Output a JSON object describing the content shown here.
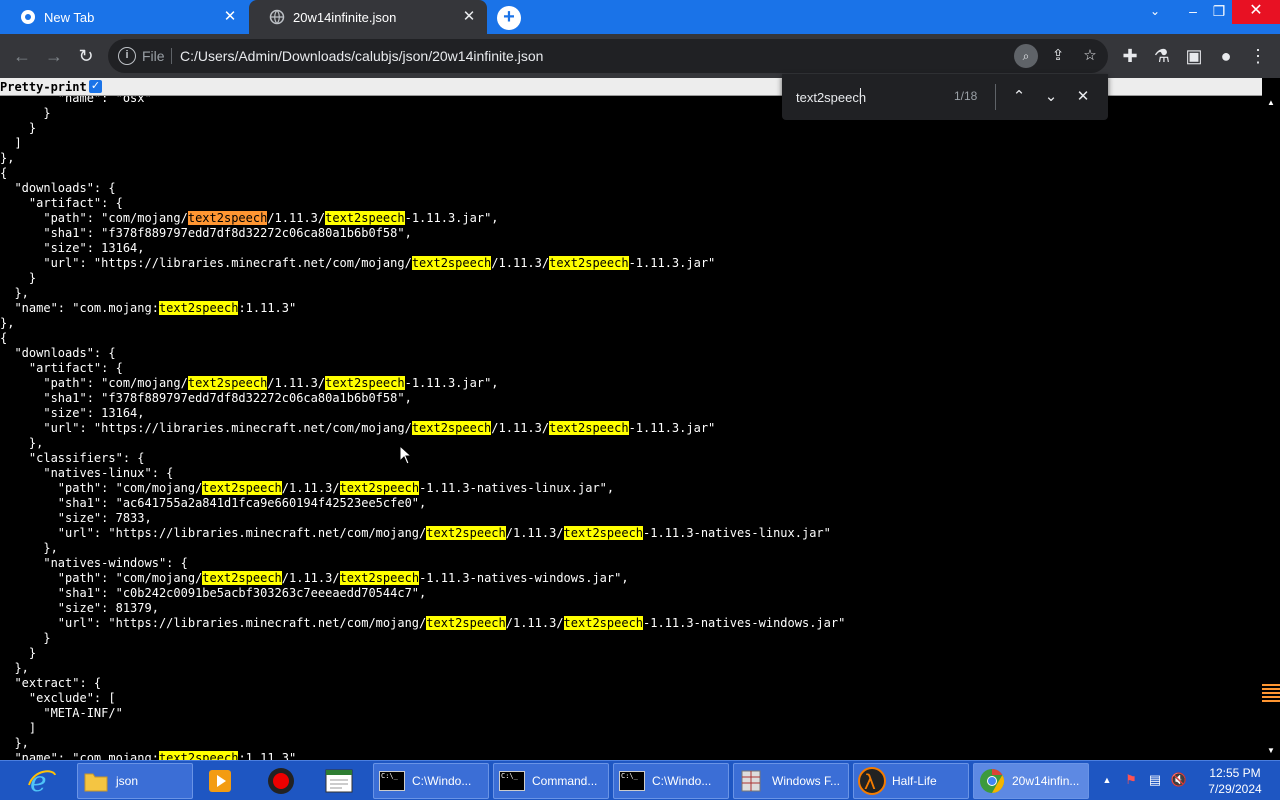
{
  "browser": {
    "tabs": [
      {
        "label": "New Tab",
        "active": false
      },
      {
        "label": "20w14infinite.json",
        "active": true
      }
    ],
    "address": {
      "scheme_label": "File",
      "url": "C:/Users/Admin/Downloads/calubjs/json/20w14infinite.json"
    }
  },
  "viewer": {
    "pretty_print_label": "Pretty-print",
    "pretty_print_checked": true
  },
  "find": {
    "query": "text2speech",
    "count": "1/18"
  },
  "code_lines": [
    [
      [
        "        \"name\": \"osx\"",
        false
      ]
    ],
    [
      [
        "      }",
        false
      ]
    ],
    [
      [
        "    }",
        false
      ]
    ],
    [
      [
        "  ]",
        false
      ]
    ],
    [
      [
        "},",
        false
      ]
    ],
    [
      [
        "{",
        false
      ]
    ],
    [
      [
        "  \"downloads\": {",
        false
      ]
    ],
    [
      [
        "    \"artifact\": {",
        false
      ]
    ],
    [
      [
        "      \"path\": \"com/mojang/",
        false
      ],
      [
        "text2speech",
        "active"
      ],
      [
        "/1.11.3/",
        false
      ],
      [
        "text2speech",
        true
      ],
      [
        "-1.11.3.jar\",",
        false
      ]
    ],
    [
      [
        "      \"sha1\": \"f378f889797edd7df8d32272c06ca80a1b6b0f58\",",
        false
      ]
    ],
    [
      [
        "      \"size\": 13164,",
        false
      ]
    ],
    [
      [
        "      \"url\": \"https://libraries.minecraft.net/com/mojang/",
        false
      ],
      [
        "text2speech",
        true
      ],
      [
        "/1.11.3/",
        false
      ],
      [
        "text2speech",
        true
      ],
      [
        "-1.11.3.jar\"",
        false
      ]
    ],
    [
      [
        "    }",
        false
      ]
    ],
    [
      [
        "  },",
        false
      ]
    ],
    [
      [
        "  \"name\": \"com.mojang:",
        false
      ],
      [
        "text2speech",
        true
      ],
      [
        ":1.11.3\"",
        false
      ]
    ],
    [
      [
        "},",
        false
      ]
    ],
    [
      [
        "{",
        false
      ]
    ],
    [
      [
        "  \"downloads\": {",
        false
      ]
    ],
    [
      [
        "    \"artifact\": {",
        false
      ]
    ],
    [
      [
        "      \"path\": \"com/mojang/",
        false
      ],
      [
        "text2speech",
        true
      ],
      [
        "/1.11.3/",
        false
      ],
      [
        "text2speech",
        true
      ],
      [
        "-1.11.3.jar\",",
        false
      ]
    ],
    [
      [
        "      \"sha1\": \"f378f889797edd7df8d32272c06ca80a1b6b0f58\",",
        false
      ]
    ],
    [
      [
        "      \"size\": 13164,",
        false
      ]
    ],
    [
      [
        "      \"url\": \"https://libraries.minecraft.net/com/mojang/",
        false
      ],
      [
        "text2speech",
        true
      ],
      [
        "/1.11.3/",
        false
      ],
      [
        "text2speech",
        true
      ],
      [
        "-1.11.3.jar\"",
        false
      ]
    ],
    [
      [
        "    },",
        false
      ]
    ],
    [
      [
        "    \"classifiers\": {",
        false
      ]
    ],
    [
      [
        "      \"natives-linux\": {",
        false
      ]
    ],
    [
      [
        "        \"path\": \"com/mojang/",
        false
      ],
      [
        "text2speech",
        true
      ],
      [
        "/1.11.3/",
        false
      ],
      [
        "text2speech",
        true
      ],
      [
        "-1.11.3-natives-linux.jar\",",
        false
      ]
    ],
    [
      [
        "        \"sha1\": \"ac641755a2a841d1fca9e660194f42523ee5cfe0\",",
        false
      ]
    ],
    [
      [
        "        \"size\": 7833,",
        false
      ]
    ],
    [
      [
        "        \"url\": \"https://libraries.minecraft.net/com/mojang/",
        false
      ],
      [
        "text2speech",
        true
      ],
      [
        "/1.11.3/",
        false
      ],
      [
        "text2speech",
        true
      ],
      [
        "-1.11.3-natives-linux.jar\"",
        false
      ]
    ],
    [
      [
        "      },",
        false
      ]
    ],
    [
      [
        "      \"natives-windows\": {",
        false
      ]
    ],
    [
      [
        "        \"path\": \"com/mojang/",
        false
      ],
      [
        "text2speech",
        true
      ],
      [
        "/1.11.3/",
        false
      ],
      [
        "text2speech",
        true
      ],
      [
        "-1.11.3-natives-windows.jar\",",
        false
      ]
    ],
    [
      [
        "        \"sha1\": \"c0b242c0091be5acbf303263c7eeeaedd70544c7\",",
        false
      ]
    ],
    [
      [
        "        \"size\": 81379,",
        false
      ]
    ],
    [
      [
        "        \"url\": \"https://libraries.minecraft.net/com/mojang/",
        false
      ],
      [
        "text2speech",
        true
      ],
      [
        "/1.11.3/",
        false
      ],
      [
        "text2speech",
        true
      ],
      [
        "-1.11.3-natives-windows.jar\"",
        false
      ]
    ],
    [
      [
        "      }",
        false
      ]
    ],
    [
      [
        "    }",
        false
      ]
    ],
    [
      [
        "  },",
        false
      ]
    ],
    [
      [
        "  \"extract\": {",
        false
      ]
    ],
    [
      [
        "    \"exclude\": [",
        false
      ]
    ],
    [
      [
        "      \"META-INF/\"",
        false
      ]
    ],
    [
      [
        "    ]",
        false
      ]
    ],
    [
      [
        "  },",
        false
      ]
    ],
    [
      [
        "  \"name\": \"com.mojang:",
        false
      ],
      [
        "text2speech",
        true
      ],
      [
        ":1.11.3\"",
        false
      ]
    ]
  ],
  "taskbar": {
    "items": [
      {
        "label": "json",
        "icon": "folder-icon"
      },
      {
        "label": "C:\\Windo...",
        "icon": "cmd-icon"
      },
      {
        "label": "Command...",
        "icon": "cmd-icon"
      },
      {
        "label": "C:\\Windo...",
        "icon": "cmd-icon"
      },
      {
        "label": "Windows F...",
        "icon": "windows-firewall-icon"
      },
      {
        "label": "Half-Life",
        "icon": "half-life-icon"
      },
      {
        "label": "20w14infin...",
        "icon": "chrome-icon"
      }
    ],
    "clock_time": "12:55 PM",
    "clock_date": "7/29/2024"
  },
  "colors": {
    "tab_strip": "#1a73e8",
    "toolbar": "#35363a",
    "match_highlight": "#ffff00",
    "active_match_highlight": "#ff9632",
    "taskbar": "#1e56c2"
  }
}
